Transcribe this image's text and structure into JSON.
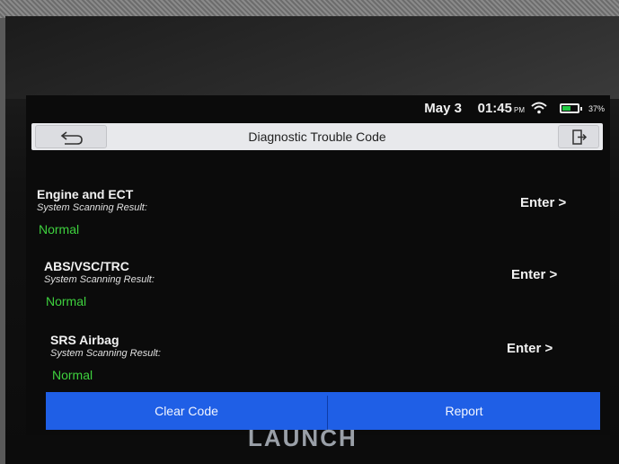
{
  "status": {
    "date": "May 3",
    "time": "01:45",
    "ampm": "PM",
    "battery": "37%",
    "battery_color": "#22cc44"
  },
  "titlebar": {
    "title": "Diagnostic Trouble Code",
    "back_icon": "back-arrow-icon",
    "exit_icon": "exit-icon"
  },
  "systems": [
    {
      "name": "Engine and ECT",
      "label": "System Scanning Result:",
      "result": "Normal",
      "action": "Enter >"
    },
    {
      "name": "ABS/VSC/TRC",
      "label": "System Scanning Result:",
      "result": "Normal",
      "action": "Enter >"
    },
    {
      "name": "SRS Airbag",
      "label": "System Scanning Result:",
      "result": "Normal",
      "action": "Enter >"
    }
  ],
  "bottom": {
    "clear_label": "Clear Code",
    "report_label": "Report",
    "accent": "#1f5fe6"
  },
  "device": {
    "brand": "LAUNCH"
  }
}
